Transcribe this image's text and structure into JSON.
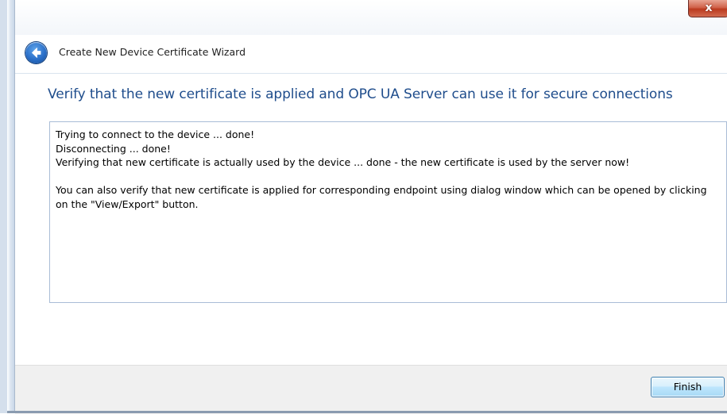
{
  "window": {
    "title": "Create New Device Certificate Wizard",
    "close_label": "x"
  },
  "page": {
    "heading": "Verify that the new certificate is applied and OPC UA Server can use it for secure connections",
    "log_lines": [
      "Trying to connect to the device ... done!",
      "Disconnecting ... done!",
      "Verifying that new certificate is actually used by the device ... done - the new certificate is used by the server now!",
      "",
      "You can also verify that new certificate is applied for corresponding endpoint using dialog window which can be opened by clicking on the \"View/Export\" button."
    ]
  },
  "buttons": {
    "finish": "Finish"
  },
  "icons": {
    "back": "back-arrow-icon",
    "close": "close-icon"
  },
  "colors": {
    "heading": "#1f4d8c",
    "close_button": "#c9472d",
    "textbox_border": "#a9bcd6",
    "button_bar": "#f0f0f0"
  }
}
